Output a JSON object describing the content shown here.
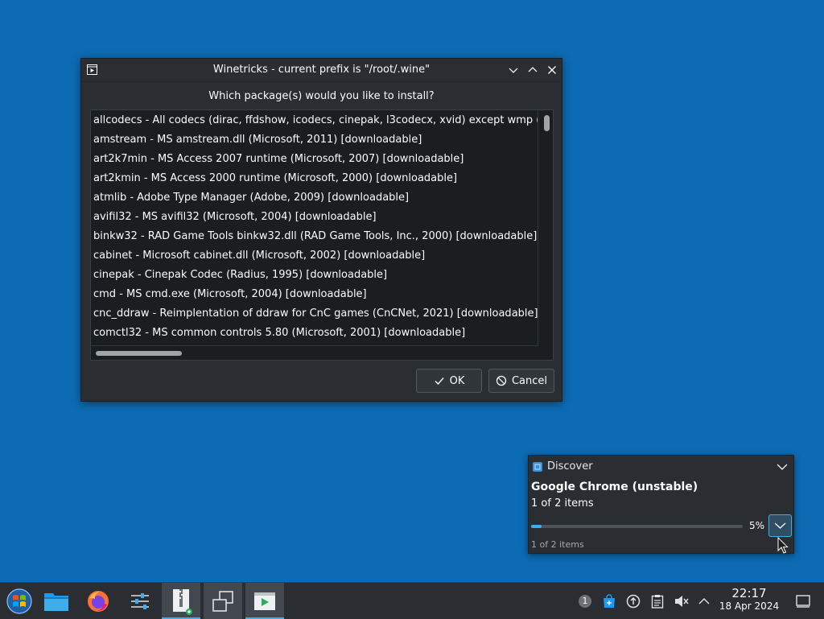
{
  "dialog": {
    "title": "Winetricks - current prefix is \"/root/.wine\"",
    "prompt": "Which package(s) would you like to install?",
    "packages": [
      "allcodecs - All codecs (dirac, ffdshow, icodecs, cinepak, l3codecx, xvid) except wmp (various,",
      "amstream - MS amstream.dll (Microsoft, 2011) [downloadable]",
      "art2k7min - MS Access 2007 runtime (Microsoft, 2007) [downloadable]",
      "art2kmin - MS Access 2000 runtime (Microsoft, 2000) [downloadable]",
      "atmlib - Adobe Type Manager (Adobe, 2009) [downloadable]",
      "avifil32 - MS avifil32 (Microsoft, 2004) [downloadable]",
      "binkw32 - RAD Game Tools binkw32.dll (RAD Game Tools, Inc., 2000) [downloadable]",
      "cabinet - Microsoft cabinet.dll (Microsoft, 2002) [downloadable]",
      "cinepak - Cinepak Codec (Radius, 1995) [downloadable]",
      "cmd - MS cmd.exe (Microsoft, 2004) [downloadable]",
      "cnc_ddraw - Reimplentation of ddraw for CnC games (CnCNet, 2021) [downloadable]",
      "comctl32 - MS common controls 5.80 (Microsoft, 2001) [downloadable]"
    ],
    "ok_label": "OK",
    "cancel_label": "Cancel"
  },
  "notification": {
    "app_name": "Discover",
    "title": "Google Chrome (unstable)",
    "body": "1 of 2 items",
    "progress_percent": 5,
    "progress_label": "5%",
    "footer": "1 of 2 items"
  },
  "taskbar": {
    "notification_count": "1",
    "time": "22:17",
    "date": "18 Apr 2024"
  },
  "colors": {
    "desktop": "#0c6bb3",
    "panel": "#2a2e32",
    "accent": "#3daee9",
    "text": "#fcfcfc"
  }
}
